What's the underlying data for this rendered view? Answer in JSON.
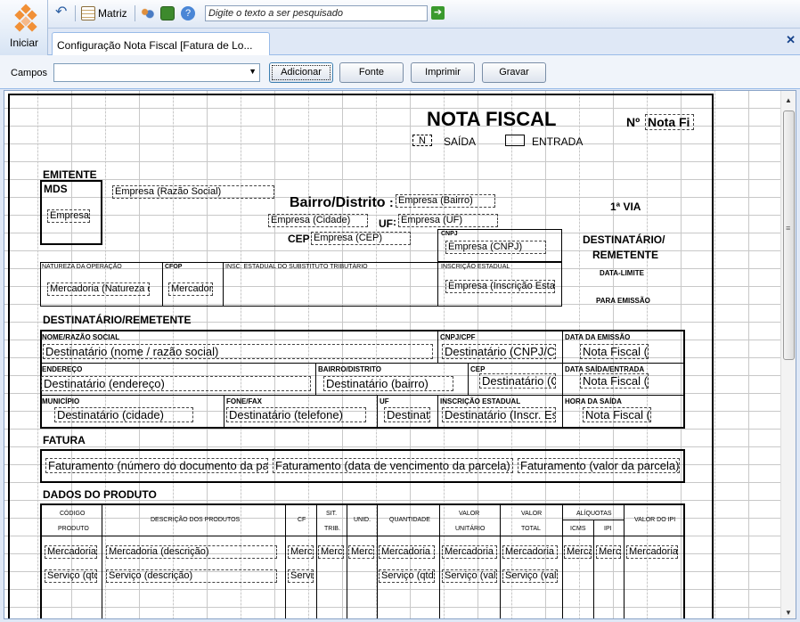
{
  "toolbar": {
    "matriz_label": "Matriz",
    "search_placeholder": "Digite o texto a ser pesquisado",
    "iniciar_label": "Iniciar"
  },
  "tab": {
    "label": "Configuração Nota Fiscal [Fatura de Lo..."
  },
  "fieldsbar": {
    "campos_label": "Campos",
    "campos_value": "",
    "add": "Adicionar",
    "font": "Fonte",
    "print": "Imprimir",
    "save": "Gravar"
  },
  "nf": {
    "title": "NOTA FISCAL",
    "numero_label": "Nº",
    "numero_field": "Nota Fi",
    "saida_mark": "N",
    "saida": "SAÍDA",
    "entrada": "ENTRADA",
    "emitente": "EMITENTE",
    "mds": "MDS",
    "empresa_logo": "Empresa",
    "razao": "Empresa (Razão Social)",
    "bairro_label": "Bairro/Distrito",
    "bairro_colon": ":",
    "bairro_field": "Empresa (Bairro)",
    "cidade_field": "Empresa (Cidade)",
    "uf_label": "UF",
    "uf_colon": ":",
    "uf_field": "Empresa (UF)",
    "cep_label": "CEP",
    "cep_field": "Empresa (CEP)",
    "cnpj_label": "CNPJ",
    "cnpj_field": "Empresa (CNPJ)",
    "via": "1ª VIA",
    "dest_rem_1": "DESTINATÁRIO/",
    "dest_rem_2": "REMETENTE",
    "data_limite": "DATA-LIMITE",
    "para_emissao": "PARA EMISSÃO",
    "natureza_label": "NATUREZA DA OPERAÇÃO",
    "natureza_field": "Mercadoria (Natureza da",
    "cfop_label": "CFOP",
    "cfop_field": "Mercadoria",
    "ie_st_label": "INSC. ESTADUAL DO SUBSTITUTO TRIBUTÁRIO",
    "ie_label": "INSCRIÇÃO ESTADUAL",
    "ie_field": "Empresa (Inscrição Estadual)",
    "dest_heading": "DESTINATÁRIO/REMETENTE",
    "nome_label": "NOME/RAZÃO SOCIAL",
    "nome_field": "Destinatário (nome / razão social)",
    "cnpjcpf_label": "CNPJ/CPF",
    "cnpjcpf_field": "Destinatário (CNPJ/CPF)",
    "emissao_label": "DATA DA EMISSÃO",
    "emissao_field": "Nota Fiscal (",
    "endereco_label": "ENDEREÇO",
    "endereco_field": "Destinatário (endereço)",
    "dbairro_label": "BAIRRO/DISTRITO",
    "dbairro_field": "Destinatário (bairro)",
    "dcep_label": "CEP",
    "dcep_field": "Destinatário (CEP)",
    "saida_label": "DATA SAÍDA/ENTRADA",
    "saida_field": "Nota Fiscal (",
    "municipio_label": "MUNICÍPIO",
    "municipio_field": "Destinatário (cidade)",
    "fone_label": "FONE/FAX",
    "fone_field": "Destinatário (telefone)",
    "duf_label": "UF",
    "duf_field": "Destinatário",
    "die_label": "INSCRIÇÃO ESTADUAL",
    "die_field": "Destinatário (Inscr. Estadual)",
    "hora_label": "HORA DA SAÍDA",
    "hora_field": "Nota Fiscal (",
    "fatura_heading": "FATURA",
    "fat_num": "Faturamento (número do documento da parcela)",
    "fat_venc": "Faturamento (data de vencimento da parcela)",
    "fat_valor": "Faturamento (valor da parcela)",
    "produto_heading": "DADOS DO PRODUTO",
    "cols": {
      "codigo": "CÓDIGO",
      "produto": "PRODUTO",
      "desc": "DESCRIÇÃO DOS PRODUTOS",
      "cf": "CF",
      "sit": "SIT.",
      "trib": "TRIB.",
      "unid": "UNID.",
      "qtd": "QUANTIDADE",
      "valor": "VALOR",
      "unitario": "UNITÁRIO",
      "total": "TOTAL",
      "aliquotas": "ALÍQUOTAS",
      "icms": "ICMS",
      "ipi": "IPI",
      "valor_ipi": "VALOR DO IPI"
    },
    "row1": {
      "codigo": "Mercadoria (código)",
      "desc": "Mercadoria (descrição)",
      "cf": "Mercadoria",
      "sit": "Mercadoria",
      "unid": "Mercadoria",
      "qtd": "Mercadoria (qtd)",
      "unit": "Mercadoria (valor)",
      "total": "Mercadoria (total)",
      "icms": "Mercadoria",
      "ipi": "Mercadoria",
      "vipi": "Mercadoria (IPI)"
    },
    "row2": {
      "codigo": "Serviço (qtd)",
      "desc": "Serviço (descrição)",
      "cf": "Serviço",
      "qtd": "Serviço (qtd)",
      "unit": "Serviço (valor)",
      "total": "Serviço (valor)"
    }
  }
}
